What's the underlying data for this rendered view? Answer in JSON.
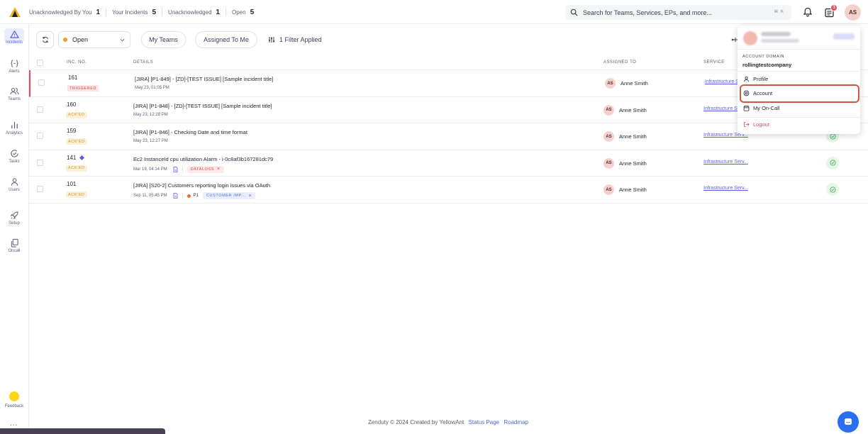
{
  "topbar": {
    "counters": [
      {
        "label": "Unacknowledged By You",
        "value": "1"
      },
      {
        "label": "Your Incidents",
        "value": "5"
      },
      {
        "label": "Unacknowledged",
        "value": "1"
      },
      {
        "label": "Open",
        "value": "5"
      }
    ],
    "search_placeholder": "Search for Teams, Services, EPs, and more...",
    "search_shortcut": "⌘ K",
    "notification_badge": "3",
    "avatar_initials": "AS"
  },
  "sidebar": {
    "items": [
      {
        "label": "Incidents",
        "icon": "warning-triangle-icon",
        "active": true
      },
      {
        "label": "Alerts",
        "icon": "braces-icon"
      },
      {
        "label": "Teams",
        "icon": "users-icon"
      },
      {
        "label": "Analytics",
        "icon": "bar-chart-icon"
      },
      {
        "label": "Tasks",
        "icon": "clock-check-icon"
      },
      {
        "label": "Users",
        "icon": "user-icon"
      },
      {
        "label": "Setup",
        "icon": "rocket-icon"
      },
      {
        "label": "Oncall",
        "icon": "copy-icon"
      }
    ],
    "feedback_label": "Feedback",
    "more_label": "..."
  },
  "filters": {
    "status_value": "Open",
    "my_teams": "My Teams",
    "assigned_to_me": "Assigned To Me",
    "filter_applied": "1 Filter Applied"
  },
  "table": {
    "columns": {
      "inc_no": "INC. NO.",
      "details": "DETAILS",
      "assigned_to": "ASSIGNED TO",
      "service": "SERVICE"
    },
    "rows": [
      {
        "inc_no": "161",
        "state": "TRIGGERED",
        "title": "[JIRA] [P1-849] - [ZD]-[TEST ISSUE] [Sample incident title]",
        "date": "May 23, 01:05 PM",
        "assignee_initials": "AS",
        "assignee": "Anne Smith",
        "service": "Infrastructure Serv..."
      },
      {
        "inc_no": "160",
        "state": "ACK'ED",
        "title": "[JIRA] [P1-848] - [ZD]-[TEST ISSUE] [Sample incident title]",
        "date": "May 23, 12:28 PM",
        "assignee_initials": "AS",
        "assignee": "Anne Smith",
        "service": "Infrastructure Serv..."
      },
      {
        "inc_no": "159",
        "state": "ACK'ED",
        "title": "[JIRA] [P1-846] - Checking Date and time format",
        "date": "May 23, 12:27 PM",
        "assignee_initials": "AS",
        "assignee": "Anne Smith",
        "service": "Infrastructure Serv..."
      },
      {
        "inc_no": "141",
        "state": "ACK'ED",
        "title": "Ec2 InstanceId cpu utilization Alarm - i-0c8af3b167281dc79",
        "date": "Mar 19, 04:14 PM",
        "tag": "DATALOSS",
        "assignee_initials": "AS",
        "assignee": "Anne Smith",
        "service": "Infrastructure Serv..."
      },
      {
        "inc_no": "101",
        "state": "ACK'ED",
        "title": "[JIRA] [S20-2] Customers reporting login issues via OAuth",
        "date": "Sep 11, 05:45 PM",
        "priority": "P1",
        "tag": "CUSTOMER IMP...",
        "assignee_initials": "AS",
        "assignee": "Anne Smith",
        "service": "Infrastructure Serv..."
      }
    ]
  },
  "dropdown": {
    "domain_label": "ACCOUNT DOMAIN",
    "domain": "rollingtestcompany",
    "items": [
      "Profile",
      "Account",
      "My On-Call",
      "Logout"
    ]
  },
  "footer": {
    "text": "Zenduty © 2024 Created by YellowAnt",
    "status_page": "Status Page",
    "roadmap": "Roadmap"
  },
  "colors": {
    "accent": "#5a5fe0",
    "triggered": "#d84a4a",
    "acked": "#d8922b",
    "highlight": "#d2573f"
  }
}
